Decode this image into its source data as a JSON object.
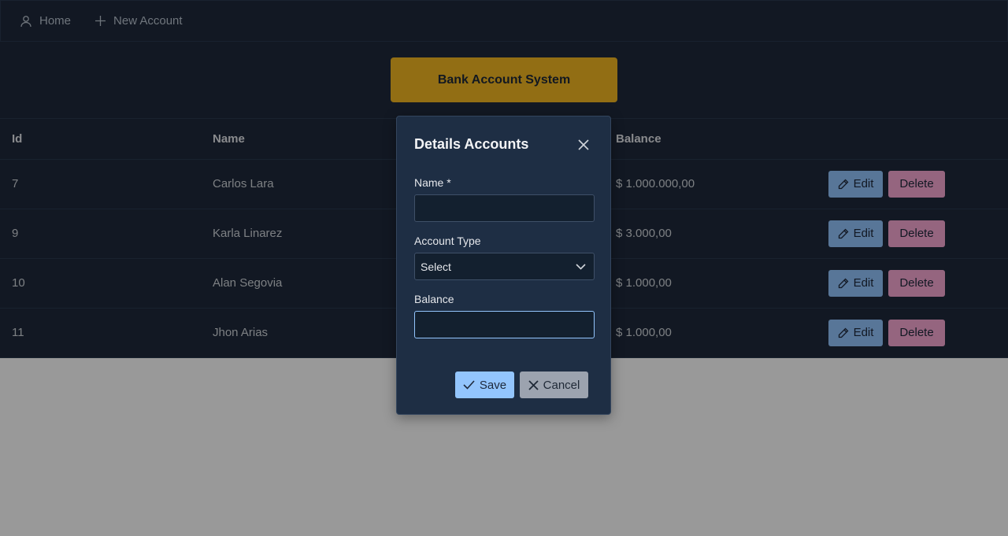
{
  "nav": {
    "home": "Home",
    "new_account": "New Account"
  },
  "banner": "Bank Account System",
  "table": {
    "headers": [
      "Id",
      "Name",
      "Balance"
    ],
    "rows": [
      {
        "id": "7",
        "name": "Carlos Lara",
        "balance": "$ 1.000.000,00"
      },
      {
        "id": "9",
        "name": "Karla Linarez",
        "balance": "$ 3.000,00"
      },
      {
        "id": "10",
        "name": "Alan Segovia",
        "balance": "$ 1.000,00"
      },
      {
        "id": "11",
        "name": "Jhon Arias",
        "balance": "$ 1.000,00"
      }
    ],
    "edit_label": "Edit",
    "delete_label": "Delete"
  },
  "dialog": {
    "title": "Details Accounts",
    "name_label": "Name *",
    "name_value": "",
    "account_type_label": "Account Type",
    "account_type_value": "Select",
    "balance_label": "Balance",
    "balance_value": "",
    "save_label": "Save",
    "cancel_label": "Cancel"
  },
  "icons": {
    "home": "user-icon",
    "new_account": "plus-icon",
    "edit": "pencil-icon",
    "close": "close-icon",
    "dropdown": "chevron-down-icon",
    "save": "check-icon",
    "cancel": "x-icon"
  },
  "colors": {
    "surface": "#1e293b",
    "banner": "#f4b722",
    "edit": "#93c5fd",
    "delete": "#f9a8d4",
    "cancel": "#9ca3af"
  }
}
